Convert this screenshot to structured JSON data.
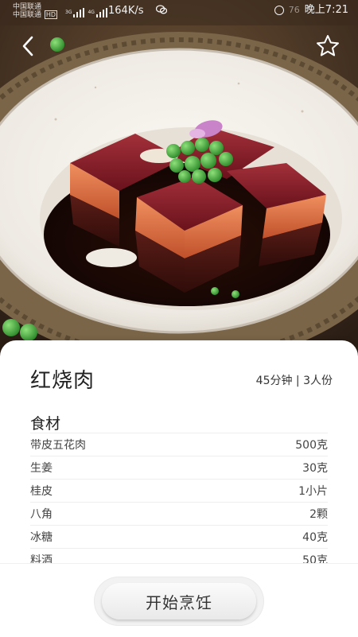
{
  "status_bar": {
    "carrier_top": "中国联通",
    "carrier_bottom": "中国联通",
    "hd": "HD",
    "net_3g": "3G",
    "net_4g": "4G",
    "speed": "164K/s",
    "time": "晚上7:21",
    "battery_hint": "76"
  },
  "recipe": {
    "name": "红烧肉",
    "meta": "45分钟 | 3人份"
  },
  "ingredients": {
    "section_title": "食材",
    "items": [
      {
        "name": "带皮五花肉",
        "amount": "500克"
      },
      {
        "name": "生姜",
        "amount": "30克"
      },
      {
        "name": "桂皮",
        "amount": "1小片"
      },
      {
        "name": "八角",
        "amount": "2颗"
      },
      {
        "name": "冰糖",
        "amount": "40克"
      },
      {
        "name": "料酒",
        "amount": "50克"
      }
    ]
  },
  "actions": {
    "start_label": "开始烹饪"
  },
  "icons": {
    "back": "chevron-left-icon",
    "favorite": "star-outline-icon"
  }
}
